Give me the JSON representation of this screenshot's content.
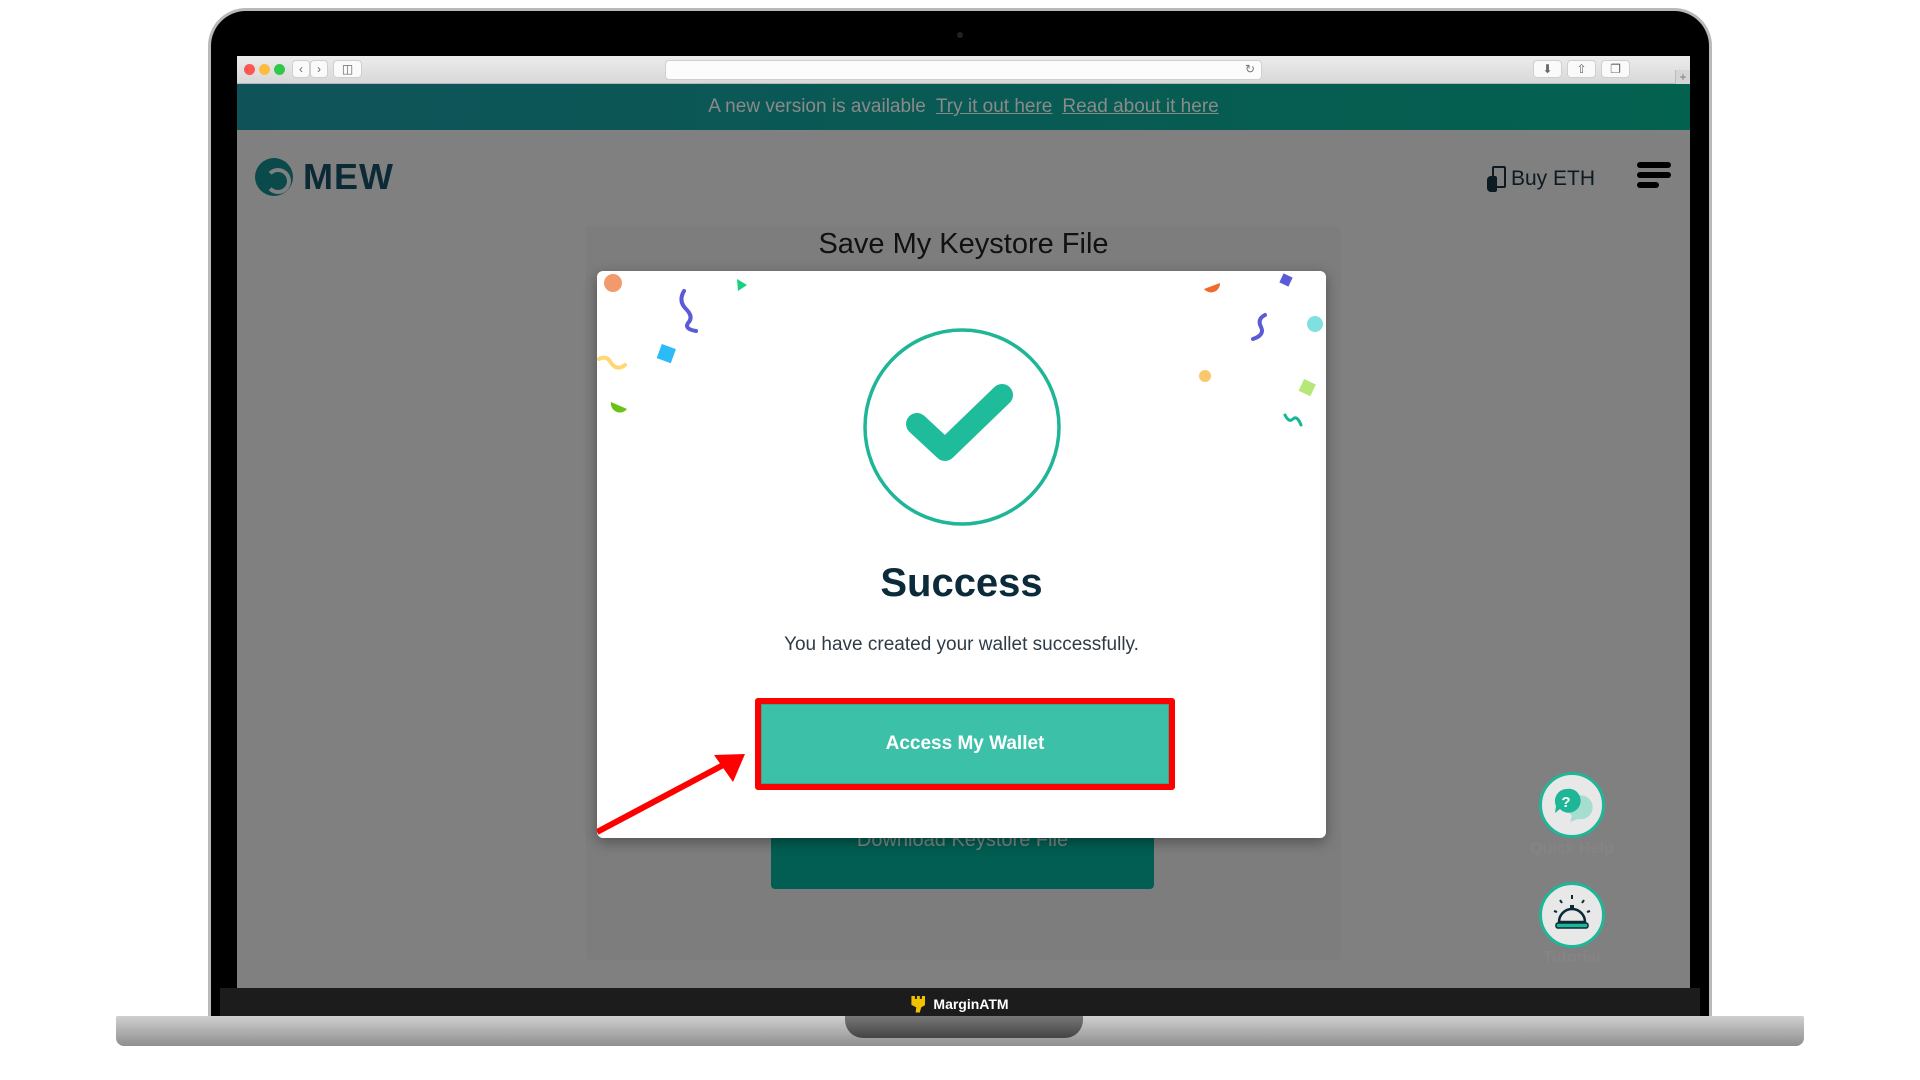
{
  "browser": {
    "url": "",
    "buttons": [
      "back",
      "forward",
      "sidebar",
      "download",
      "share",
      "tabs",
      "new-tab"
    ]
  },
  "banner": {
    "message": "A new version is available",
    "try_link": "Try it out here",
    "read_link": "Read about it here"
  },
  "header": {
    "logo_text": "MEW",
    "buy_label": "Buy ETH"
  },
  "page": {
    "title": "Save My Keystore File",
    "download_label": "Download Keystore File"
  },
  "fabs": {
    "help_label": "Quick Help",
    "tutorial_label": "Tutorial"
  },
  "modal": {
    "title": "Success",
    "message": "You have created your wallet successfully.",
    "button_label": "Access My Wallet"
  },
  "colors": {
    "accent": "#1fb597",
    "button": "#3cc0a8",
    "banner": "#0f5359",
    "highlight": "#ff0000"
  },
  "laptop": {
    "brand_label": "MarginATM"
  }
}
